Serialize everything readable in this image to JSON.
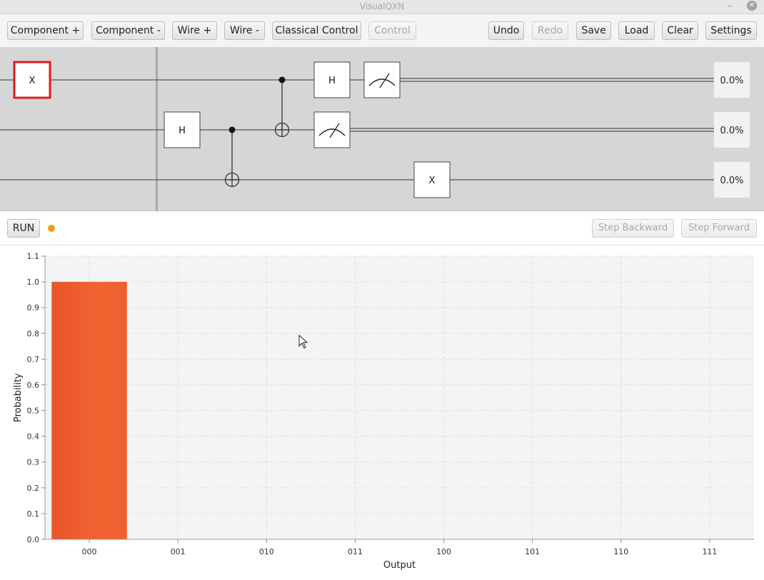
{
  "window": {
    "title": "VisualQXN",
    "minimize_glyph": "–",
    "close_glyph": "✕"
  },
  "toolbar": {
    "left": [
      {
        "id": "component-plus",
        "label": "Component +",
        "enabled": true
      },
      {
        "id": "component-minus",
        "label": "Component -",
        "enabled": true
      },
      {
        "id": "wire-plus",
        "label": "Wire +",
        "enabled": true
      },
      {
        "id": "wire-minus",
        "label": "Wire -",
        "enabled": true
      },
      {
        "id": "classical-control",
        "label": "Classical Control",
        "enabled": true
      },
      {
        "id": "control",
        "label": "Control",
        "enabled": false
      }
    ],
    "right": [
      {
        "id": "undo",
        "label": "Undo",
        "enabled": true
      },
      {
        "id": "redo",
        "label": "Redo",
        "enabled": false
      },
      {
        "id": "save",
        "label": "Save",
        "enabled": true
      },
      {
        "id": "load",
        "label": "Load",
        "enabled": true
      },
      {
        "id": "clear",
        "label": "Clear",
        "enabled": true
      },
      {
        "id": "settings",
        "label": "Settings",
        "enabled": true
      }
    ]
  },
  "circuit": {
    "wires": 3,
    "palette_gate": {
      "label": "X",
      "selected": true
    },
    "gates": [
      {
        "type": "H",
        "label": "H",
        "wire": 1,
        "column": 0
      },
      {
        "type": "CNOT",
        "control_wire": 1,
        "target_wire": 2,
        "column": 1
      },
      {
        "type": "CNOT",
        "control_wire": 0,
        "target_wire": 1,
        "column": 2
      },
      {
        "type": "H",
        "label": "H",
        "wire": 0,
        "column": 3
      },
      {
        "type": "measure",
        "wire": 1,
        "column": 3
      },
      {
        "type": "measure",
        "wire": 0,
        "column": 4
      },
      {
        "type": "X",
        "label": "X",
        "wire": 2,
        "column": 5
      }
    ],
    "probabilities": [
      "0.0%",
      "0.0%",
      "0.0%"
    ],
    "colors": {
      "selected_border": "#e01b1b",
      "wire": "#555555",
      "background": "#d6d6d6"
    }
  },
  "run": {
    "run_label": "RUN",
    "status_color": "#f0a011",
    "step_backward_label": "Step Backward",
    "step_forward_label": "Step Forward"
  },
  "chart_data": {
    "type": "bar",
    "categories": [
      "000",
      "001",
      "010",
      "011",
      "100",
      "101",
      "110",
      "111"
    ],
    "values": [
      1.0,
      0,
      0,
      0,
      0,
      0,
      0,
      0
    ],
    "xlabel": "Output",
    "ylabel": "Probability",
    "ylim": [
      0,
      1.1
    ],
    "yticks": [
      "0.0",
      "0.1",
      "0.2",
      "0.3",
      "0.4",
      "0.5",
      "0.6",
      "0.7",
      "0.8",
      "0.9",
      "1.0",
      "1.1"
    ],
    "grid": true,
    "bar_color": "#f0602e",
    "plot_background": "#f4f4f4"
  }
}
